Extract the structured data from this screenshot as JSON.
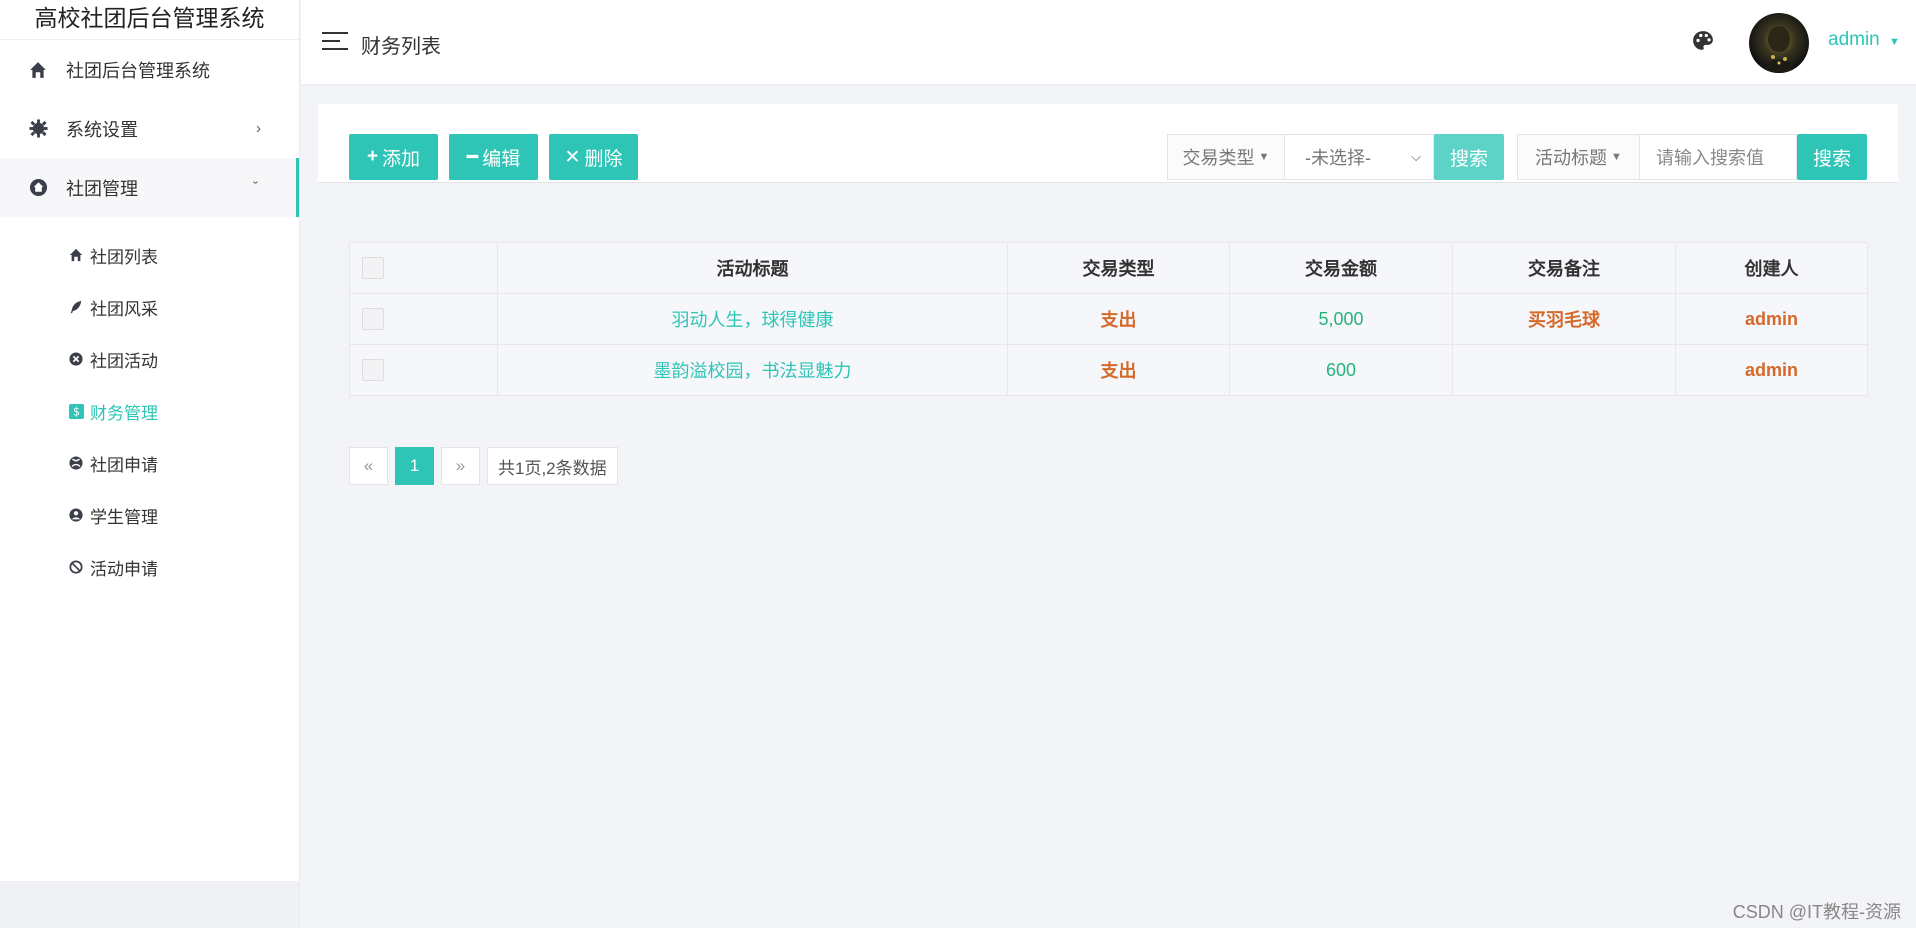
{
  "sidebar": {
    "brand": "高校社团后台管理系统",
    "top_items": [
      {
        "label": "社团后台管理系统",
        "icon": "home-icon"
      },
      {
        "label": "系统设置",
        "icon": "gear-icon",
        "chevron": "›"
      },
      {
        "label": "社团管理",
        "icon": "house-circle-icon",
        "chevron": "ˇ"
      }
    ],
    "sub_items": [
      {
        "label": "社团列表",
        "icon": "home-icon"
      },
      {
        "label": "社团风采",
        "icon": "feather-icon"
      },
      {
        "label": "社团活动",
        "icon": "x-circle-icon"
      },
      {
        "label": "财务管理",
        "icon": "dollar-icon"
      },
      {
        "label": "社团申请",
        "icon": "xbox-icon"
      },
      {
        "label": "学生管理",
        "icon": "user-circle-icon"
      },
      {
        "label": "活动申请",
        "icon": "ban-icon"
      }
    ]
  },
  "header": {
    "title": "财务列表",
    "user": "admin"
  },
  "toolbar": {
    "add_label": "添加",
    "edit_label": "编辑",
    "delete_label": "删除",
    "type_label": "交易类型",
    "type_value": "-未选择-",
    "search_label": "搜索",
    "title_label": "活动标题",
    "keyword_placeholder": "请输入搜索值",
    "search2_label": "搜索"
  },
  "table": {
    "headers": [
      "活动标题",
      "交易类型",
      "交易金额",
      "交易备注",
      "创建人"
    ],
    "rows": [
      {
        "title": "羽动人生，球得健康",
        "type": "支出",
        "amount": "5,000",
        "note": "买羽毛球",
        "creator": "admin"
      },
      {
        "title": "墨韵溢校园，书法显魅力",
        "type": "支出",
        "amount": "600",
        "note": "",
        "creator": "admin"
      }
    ]
  },
  "pager": {
    "prev": "«",
    "current": "1",
    "next": "»",
    "info": "共1页,2条数据"
  },
  "watermark": "CSDN @IT教程-资源",
  "colors": {
    "accent": "#2ec4b6",
    "warning": "#d4692a",
    "success": "#26b47a"
  }
}
